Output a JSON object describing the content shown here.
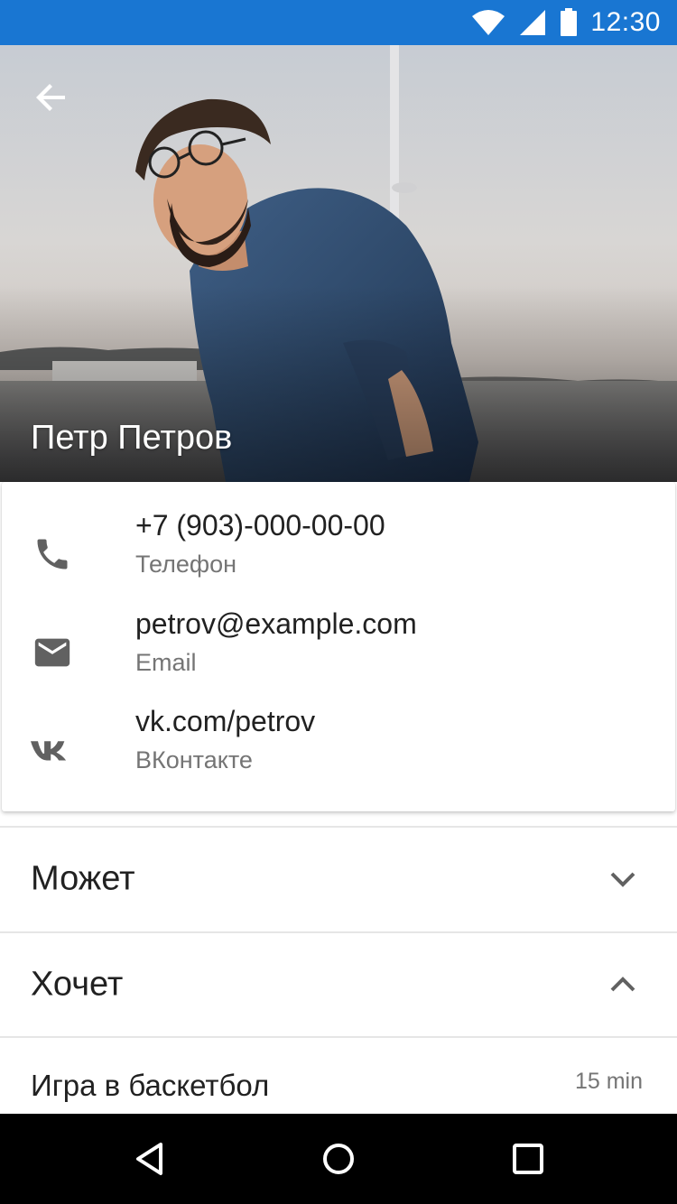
{
  "status_bar": {
    "time": "12:30",
    "icons": [
      "wifi-icon",
      "signal-icon",
      "battery-icon"
    ],
    "background": "#1976d2"
  },
  "profile": {
    "name": "Петр Петров",
    "back_icon": "arrow-back-icon"
  },
  "contacts": [
    {
      "icon": "phone-icon",
      "value": "+7 (903)-000-00-00",
      "label": "Телефон"
    },
    {
      "icon": "email-icon",
      "value": "petrov@example.com",
      "label": "Email"
    },
    {
      "icon": "vk-icon",
      "value": "vk.com/petrov",
      "label": "ВКонтакте"
    }
  ],
  "sections": [
    {
      "title": "Может",
      "state": "collapsed",
      "icon": "chevron-down-icon"
    },
    {
      "title": "Хочет",
      "state": "expanded",
      "icon": "chevron-up-icon"
    }
  ],
  "wants_items": [
    {
      "label": "Игра в баскетбол",
      "duration": "15 min"
    }
  ],
  "nav_bar": {
    "icons": [
      "back-triangle-icon",
      "home-circle-icon",
      "recents-square-icon"
    ]
  }
}
